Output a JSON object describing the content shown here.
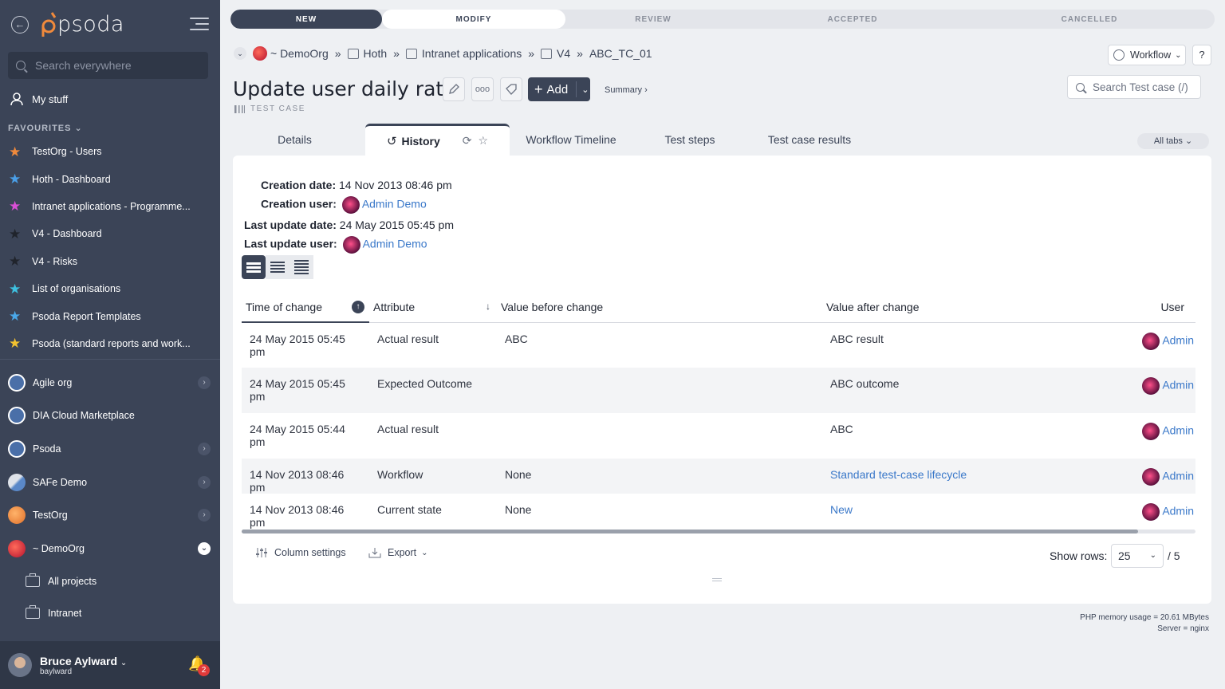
{
  "sidebar": {
    "logo": "psoda",
    "search_placeholder": "Search everywhere",
    "my_stuff": "My stuff",
    "favourites_heading": "FAVOURITES",
    "favourites": [
      {
        "label": "TestOrg - Users",
        "color": "#f08a3c"
      },
      {
        "label": "Hoth - Dashboard",
        "color": "#4a9fe8"
      },
      {
        "label": "Intranet applications - Programme...",
        "color": "#d94fd6"
      },
      {
        "label": "V4 - Dashboard",
        "color": "#2a2f3a"
      },
      {
        "label": "V4 - Risks",
        "color": "#2a2f3a"
      },
      {
        "label": "List of organisations",
        "color": "#3ec0e0"
      },
      {
        "label": "Psoda Report Templates",
        "color": "#4aa8e8"
      },
      {
        "label": "Psoda (standard reports and work...",
        "color": "#f2c230"
      }
    ],
    "orgs": [
      {
        "label": "Agile org",
        "chevron": true
      },
      {
        "label": "DIA Cloud Marketplace",
        "chevron": false
      },
      {
        "label": "Psoda",
        "chevron": true
      },
      {
        "label": "SAFe Demo",
        "chevron": true
      },
      {
        "label": "TestOrg",
        "chevron": true
      },
      {
        "label": "~ DemoOrg",
        "chevron": true
      }
    ],
    "sub_items": [
      "All projects",
      "Intranet"
    ],
    "user": {
      "name": "Bruce Aylward",
      "handle": "baylward",
      "notifications": "2"
    }
  },
  "stages": [
    "NEW",
    "MODIFY",
    "REVIEW",
    "ACCEPTED",
    "CANCELLED"
  ],
  "breadcrumb": [
    "~ DemoOrg",
    "Hoth",
    "Intranet applications",
    "V4",
    "ABC_TC_01"
  ],
  "workflow_label": "Workflow",
  "help_label": "?",
  "title": "Update user daily rate",
  "add_label": "Add",
  "summary_label": "Summary ›",
  "subtitle": "TEST CASE",
  "search_tc_placeholder": "Search Test case (/)",
  "tabs": [
    "Details",
    "History",
    "Workflow Timeline",
    "Test steps",
    "Test case results"
  ],
  "all_tabs": "All tabs",
  "meta": {
    "creation_date_label": "Creation date:",
    "creation_date": "14 Nov 2013 08:46 pm",
    "creation_user_label": "Creation user:",
    "creation_user": "Admin Demo",
    "last_update_date_label": "Last update date:",
    "last_update_date": "24 May 2015 05:45 pm",
    "last_update_user_label": "Last update user:",
    "last_update_user": "Admin Demo"
  },
  "table": {
    "columns": [
      "Time of change",
      "Attribute",
      "Value before change",
      "Value after change",
      "User"
    ],
    "rows": [
      {
        "time": "24 May 2015 05:45 pm",
        "attribute": "Actual result",
        "before": "ABC",
        "after": "ABC result",
        "after_link": false,
        "user": "Admin"
      },
      {
        "time": "24 May 2015 05:45 pm",
        "attribute": "Expected Outcome",
        "before": "",
        "after": "ABC outcome",
        "after_link": false,
        "user": "Admin"
      },
      {
        "time": "24 May 2015 05:44 pm",
        "attribute": "Actual result",
        "before": "",
        "after": "ABC",
        "after_link": false,
        "user": "Admin"
      },
      {
        "time": "14 Nov 2013 08:46 pm",
        "attribute": "Workflow",
        "before": "None",
        "after": "Standard test-case lifecycle",
        "after_link": true,
        "user": "Admin"
      },
      {
        "time": "14 Nov 2013 08:46 pm",
        "attribute": "Current state",
        "before": "None",
        "after": "New",
        "after_link": true,
        "user": "Admin"
      }
    ]
  },
  "footer": {
    "column_settings": "Column settings",
    "export": "Export",
    "show_rows_label": "Show rows:",
    "show_rows_value": "25",
    "total": "/ 5"
  },
  "php": {
    "memory": "PHP memory usage = 20.61 MBytes",
    "server": "Server = nginx"
  }
}
